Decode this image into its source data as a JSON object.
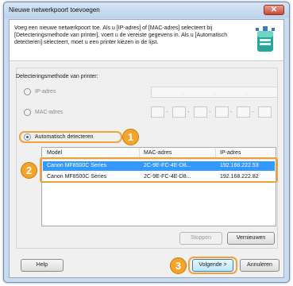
{
  "window": {
    "title": "Nieuwe netwerkpoort toevoegen",
    "close_label": "✕"
  },
  "description": "Voeg een nieuwe netwerkpoort toe. Als u [IP-adres] of [MAC-adres] selecteert bij [Detecteringsmethode van printer], voert u de vereiste gegevens in. Als u [Automatisch detecteren] selecteert, moet u een printer kiezen in de lijst.",
  "detection": {
    "group_label": "Detecteringsmethode van printer:",
    "options": [
      {
        "label": "IP-adres",
        "checked": false
      },
      {
        "label": "MAC-adres",
        "checked": false
      },
      {
        "label": "Automatisch detecteren",
        "checked": true
      }
    ]
  },
  "printer_list": {
    "columns": [
      "Model",
      "MAC-adres",
      "IP-adres"
    ],
    "rows": [
      {
        "model": "Canon MF8500C Series",
        "mac": "2C-9E-FC-4E-D8...",
        "ip": "192.168.222.53",
        "selected": true
      },
      {
        "model": "Canon MF8500C Series",
        "mac": "2C-9E-FC-4E-D8...",
        "ip": "192.168.222.82",
        "selected": false
      }
    ]
  },
  "buttons": {
    "stop": "Stoppen",
    "refresh": "Vernieuwen",
    "help": "Help",
    "next": "Volgende >",
    "cancel": "Annuleren"
  },
  "callouts": [
    "1",
    "2",
    "3"
  ],
  "colors": {
    "accent": "#f5a428",
    "selection": "#3399ff"
  }
}
